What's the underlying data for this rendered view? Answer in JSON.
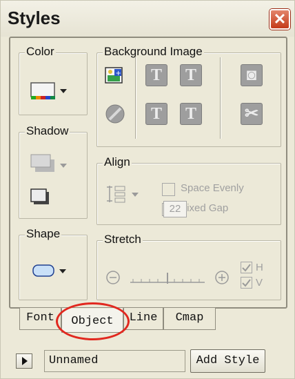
{
  "window": {
    "title": "Styles",
    "close_label": "✕"
  },
  "groups": {
    "color": "Color",
    "shadow": "Shadow",
    "shape": "Shape",
    "background_image": "Background Image",
    "align": "Align",
    "stretch": "Stretch"
  },
  "align": {
    "space_evenly_label": "Space Evenly",
    "fixed_gap_label": "Fixed Gap",
    "fixed_gap_value": "22"
  },
  "stretch": {
    "h_label": "H",
    "v_label": "V"
  },
  "tabs": [
    {
      "label": "Font"
    },
    {
      "label": "Object"
    },
    {
      "label": "Line"
    },
    {
      "label": "Cmap"
    }
  ],
  "footer": {
    "style_name": "Unnamed",
    "add_style_label": "Add Style"
  },
  "colors": {
    "accent_red": "#e1281f",
    "close_red": "#c43a1a"
  }
}
